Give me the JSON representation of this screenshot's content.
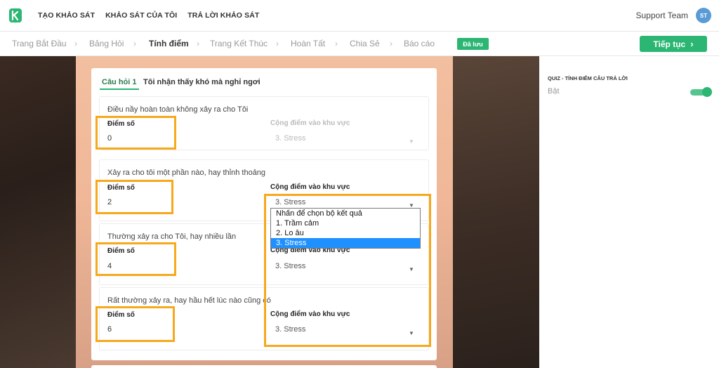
{
  "nav": {
    "items": [
      "TẠO KHẢO SÁT",
      "KHẢO SÁT CỦA TÔI",
      "TRẢ LỜI KHẢO SÁT"
    ],
    "user_name": "Support Team",
    "avatar_initials": "ST"
  },
  "breadcrumb": {
    "steps": [
      "Trang Bắt Đầu",
      "Bảng Hỏi",
      "Tính điểm",
      "Trang Kết Thúc",
      "Hoàn Tất",
      "Chia Sẻ",
      "Báo cáo"
    ],
    "active_index": 2,
    "saved_badge": "Đã lưu",
    "next_button": "Tiếp tục"
  },
  "settings": {
    "title": "QUIZ - TÍNH ĐIỂM CÂU TRẢ LỜI",
    "value": "Bật",
    "toggle_on": true
  },
  "question": {
    "number": "Câu hỏi 1",
    "text": "Tôi nhận thấy khó mà nghỉ ngơi",
    "score_label": "Điểm số",
    "area_label": "Cộng điểm vào khu vực",
    "answers": [
      {
        "text": "Điều nầy hoàn toàn không xảy ra cho Tôi",
        "score": "0",
        "area": "3. Stress"
      },
      {
        "text": "Xảy ra cho tôi một phần nào, hay thỉnh thoảng",
        "score": "2",
        "area": "3. Stress"
      },
      {
        "text": "Thường xảy ra cho Tôi, hay nhiều lần",
        "score": "4",
        "area": "3. Stress"
      },
      {
        "text": "Rất thường xảy ra, hay hầu hết lúc nào cũng có",
        "score": "6",
        "area": "3. Stress"
      }
    ]
  },
  "dropdown": {
    "options": [
      "Nhấn để chọn bộ kết quả",
      "1. Trầm cảm",
      "2. Lo âu",
      "3. Stress"
    ],
    "selected_index": 3
  },
  "colors": {
    "accent": "#2bb673",
    "highlight": "#f7a81b",
    "selected": "#1e90ff"
  }
}
